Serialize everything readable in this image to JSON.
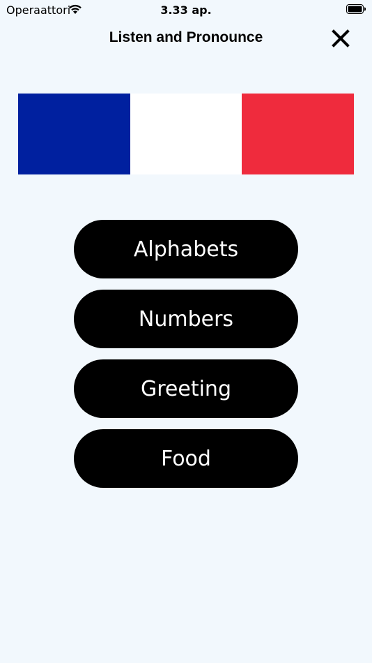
{
  "status_bar": {
    "carrier": "Operaattori",
    "time": "3.33 ap.",
    "wifi_icon": "wifi-icon",
    "battery_icon": "battery-icon"
  },
  "header": {
    "title": "Listen and Pronounce",
    "close_icon": "close-icon"
  },
  "flag": {
    "colors": [
      "#00209f",
      "#ffffff",
      "#ef2b3d"
    ]
  },
  "menu": {
    "items": [
      {
        "label": "Alphabets"
      },
      {
        "label": "Numbers"
      },
      {
        "label": "Greeting"
      },
      {
        "label": "Food"
      }
    ]
  },
  "colors": {
    "background": "#f2f8fd",
    "button_bg": "#000000",
    "button_text": "#ffffff"
  }
}
